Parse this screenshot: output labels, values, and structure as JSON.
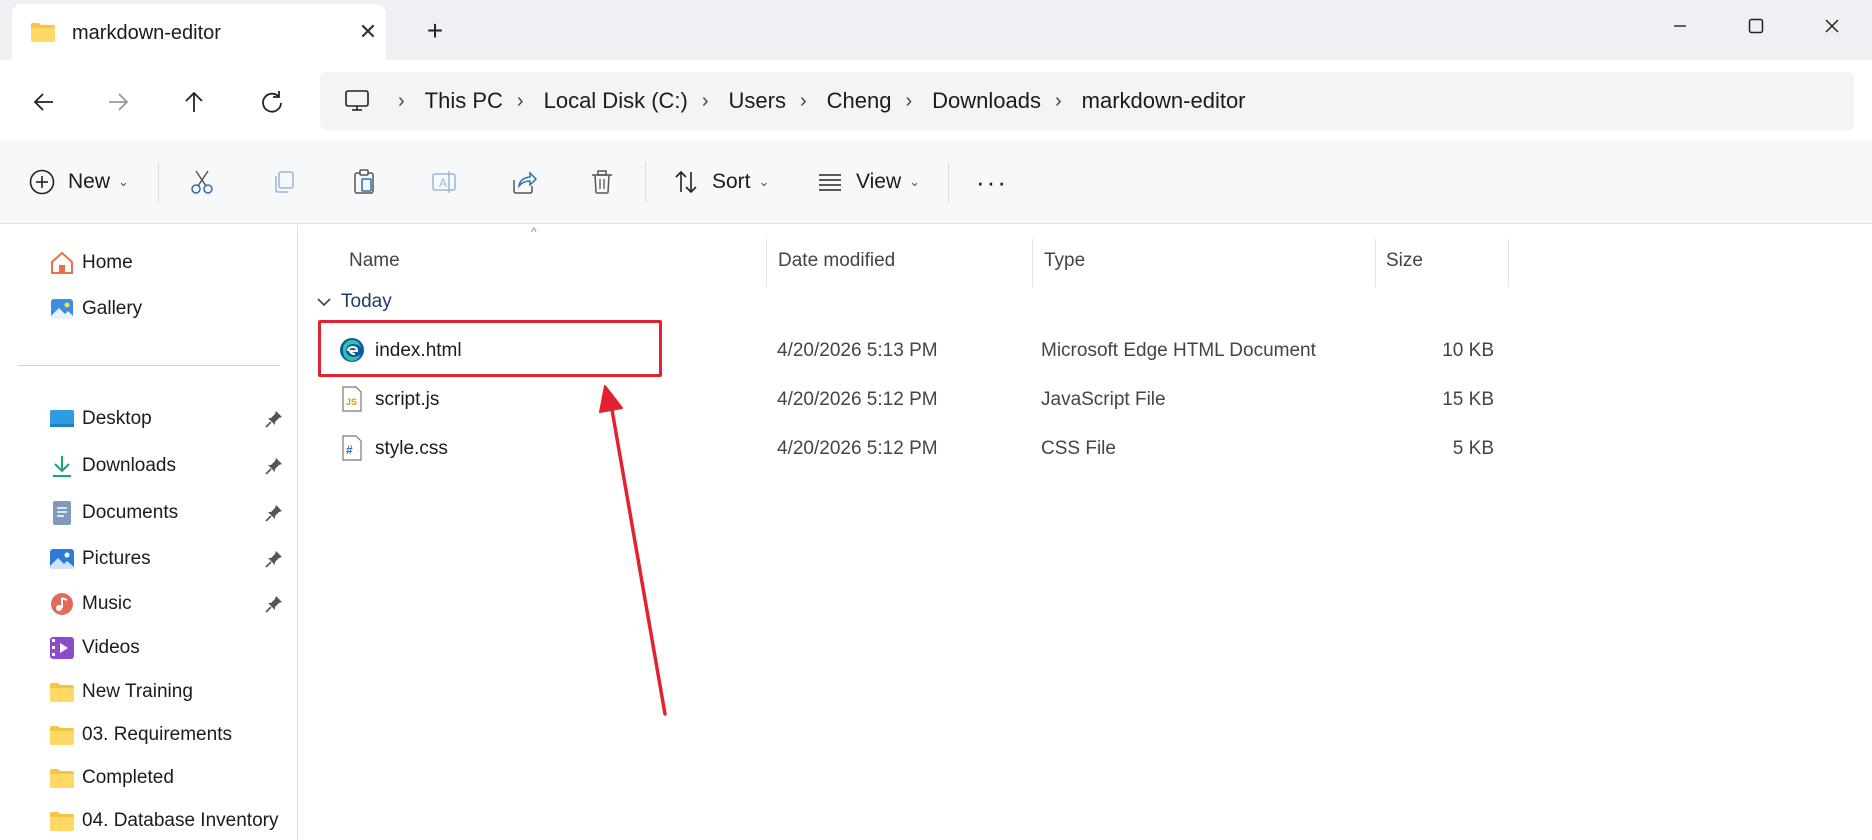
{
  "tab": {
    "title": "markdown-editor",
    "close_symbol": "✕",
    "new_tab_symbol": "+"
  },
  "breadcrumb": [
    "This PC",
    "Local Disk (C:)",
    "Users",
    "Cheng",
    "Downloads",
    "markdown-editor"
  ],
  "toolbar": {
    "new_label": "New",
    "sort_label": "Sort",
    "view_label": "View",
    "more_symbol": "···",
    "icons": [
      "plus-circle-icon",
      "cut-icon",
      "copy-icon",
      "paste-icon",
      "rename-icon",
      "share-icon",
      "delete-icon",
      "sort-icon",
      "view-icon",
      "more-icon"
    ]
  },
  "sidebar": {
    "top": [
      {
        "label": "Home",
        "icon": "home-icon"
      },
      {
        "label": "Gallery",
        "icon": "gallery-icon"
      }
    ],
    "quick": [
      {
        "label": "Desktop",
        "icon": "desktop-icon",
        "pinned": true
      },
      {
        "label": "Downloads",
        "icon": "downloads-icon",
        "pinned": true
      },
      {
        "label": "Documents",
        "icon": "documents-icon",
        "pinned": true
      },
      {
        "label": "Pictures",
        "icon": "pictures-icon",
        "pinned": true
      },
      {
        "label": "Music",
        "icon": "music-icon",
        "pinned": true
      },
      {
        "label": "Videos",
        "icon": "videos-icon",
        "pinned": false
      },
      {
        "label": "New Training",
        "icon": "folder-icon",
        "pinned": false
      },
      {
        "label": "03. Requirements",
        "icon": "folder-icon",
        "pinned": false
      },
      {
        "label": "Completed",
        "icon": "folder-icon",
        "pinned": false
      },
      {
        "label": "04. Database Inventory",
        "icon": "folder-icon",
        "pinned": false
      }
    ]
  },
  "columns": {
    "name": "Name",
    "date": "Date modified",
    "type": "Type",
    "size": "Size"
  },
  "group": {
    "label": "Today"
  },
  "files": [
    {
      "name": "index.html",
      "date": "4/20/2026 5:13 PM",
      "type": "Microsoft Edge HTML Document",
      "size": "10 KB",
      "icon": "edge-icon",
      "highlighted": true
    },
    {
      "name": "script.js",
      "date": "4/20/2026 5:12 PM",
      "type": "JavaScript File",
      "size": "15 KB",
      "icon": "js-file-icon",
      "highlighted": false
    },
    {
      "name": "style.css",
      "date": "4/20/2026 5:12 PM",
      "type": "CSS File",
      "size": "5 KB",
      "icon": "css-file-icon",
      "highlighted": false
    }
  ],
  "colors": {
    "highlight": "#e0232e",
    "folder": "#f4c542",
    "accent": "#0067c0",
    "group_text": "#1f3a6b"
  }
}
